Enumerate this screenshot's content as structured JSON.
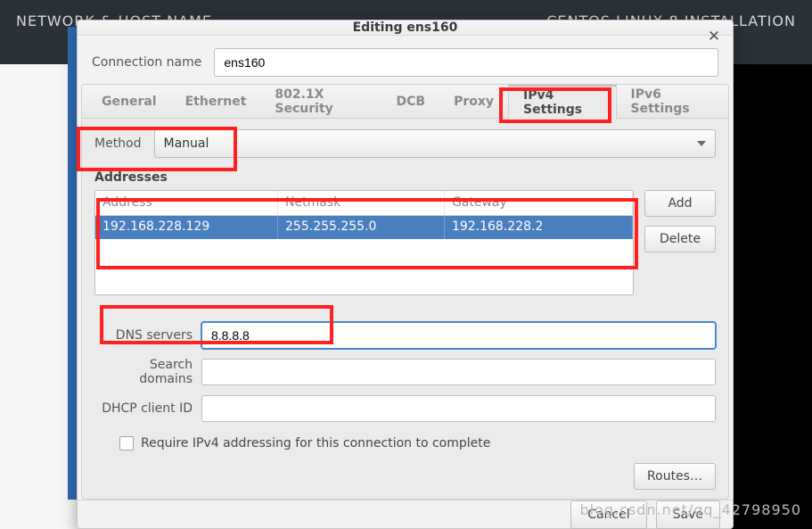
{
  "bg": {
    "left": "NETWORK & HOST NAME",
    "right": "CENTOS LINUX 8 INSTALLATION"
  },
  "watermark": "blog.csdn.net/qq_42798950",
  "dialog": {
    "title": "Editing ens160",
    "connection_label": "Connection name",
    "connection_value": "ens160",
    "tabs": [
      "General",
      "Ethernet",
      "802.1X Security",
      "DCB",
      "Proxy",
      "IPv4 Settings",
      "IPv6 Settings"
    ],
    "active_tab": 5,
    "method_label": "Method",
    "method_value": "Manual",
    "addresses_heading": "Addresses",
    "addr_headers": {
      "address": "Address",
      "netmask": "Netmask",
      "gateway": "Gateway"
    },
    "addr_rows": [
      {
        "address": "192.168.228.129",
        "netmask": "255.255.255.0",
        "gateway": "192.168.228.2"
      }
    ],
    "add_label": "Add",
    "delete_label": "Delete",
    "dns_label": "DNS servers",
    "dns_value": "8.8.8.8",
    "search_label": "Search domains",
    "search_value": "",
    "dhcpid_label": "DHCP client ID",
    "dhcpid_value": "",
    "require_label": "Require IPv4 addressing for this connection to complete",
    "routes_label": "Routes…",
    "cancel_label": "Cancel",
    "save_label": "Save"
  }
}
